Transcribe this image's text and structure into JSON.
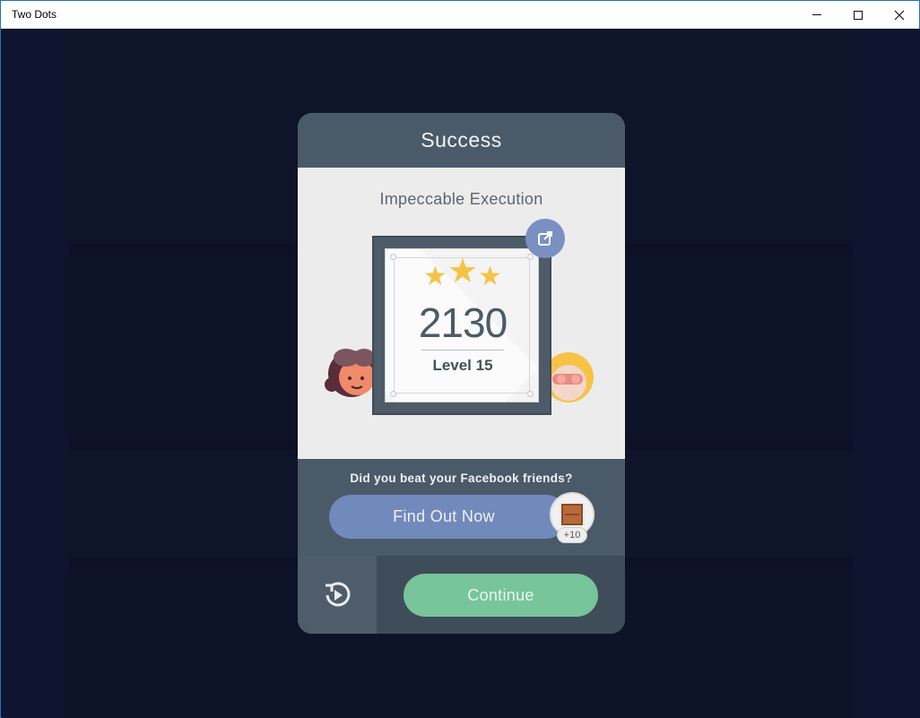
{
  "window": {
    "title": "Two Dots"
  },
  "card": {
    "title": "Success",
    "subtitle": "Impeccable Execution",
    "score": "2130",
    "level": "Level 15",
    "stars": 3,
    "facebook_prompt": "Did you beat your Facebook friends?",
    "find_out_label": "Find Out Now",
    "reward_badge": "+10",
    "continue_label": "Continue"
  },
  "colors": {
    "background": "#0c1126",
    "card_header": "#4b5a69",
    "card_body": "#ececec",
    "find_out_button": "#7289bc",
    "continue_button": "#78c49b",
    "star": "#f6c346"
  }
}
